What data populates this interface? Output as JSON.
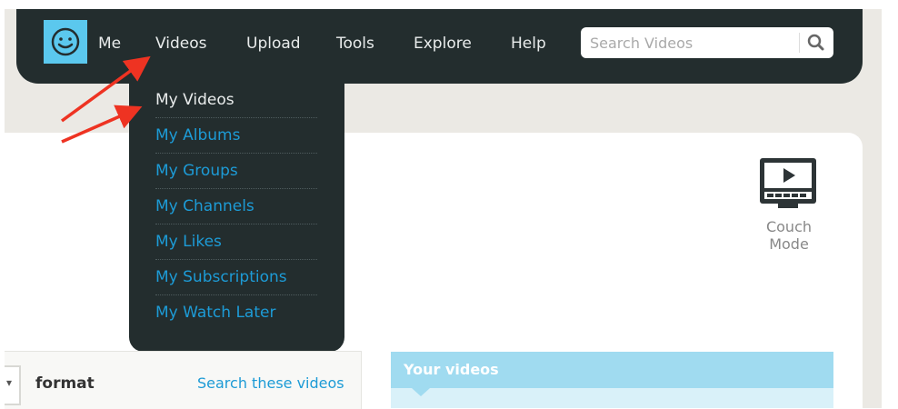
{
  "topbar": {
    "nav": [
      {
        "label": "Me"
      },
      {
        "label": "Videos"
      },
      {
        "label": "Upload"
      },
      {
        "label": "Tools"
      },
      {
        "label": "Explore"
      },
      {
        "label": "Help"
      }
    ],
    "search": {
      "placeholder": "Search Videos",
      "icon": "search-icon"
    }
  },
  "dropdown": {
    "items": [
      {
        "label": "My Videos",
        "active": true
      },
      {
        "label": "My Albums"
      },
      {
        "label": "My Groups"
      },
      {
        "label": "My Channels"
      },
      {
        "label": "My Likes"
      },
      {
        "label": "My Subscriptions"
      },
      {
        "label": "My Watch Later"
      }
    ]
  },
  "couch_mode": {
    "label": "Couch Mode",
    "icon": "tv-icon"
  },
  "filter_bar": {
    "format_label": "format",
    "search_link": "Search these videos"
  },
  "your_videos": {
    "title": "Your videos"
  },
  "colors": {
    "topbar": "#232d2e",
    "link": "#1d9bd6",
    "logo_bg": "#5bc8ee",
    "annotation_arrow": "#ee3322",
    "your_videos_header": "#a0dbf0"
  }
}
